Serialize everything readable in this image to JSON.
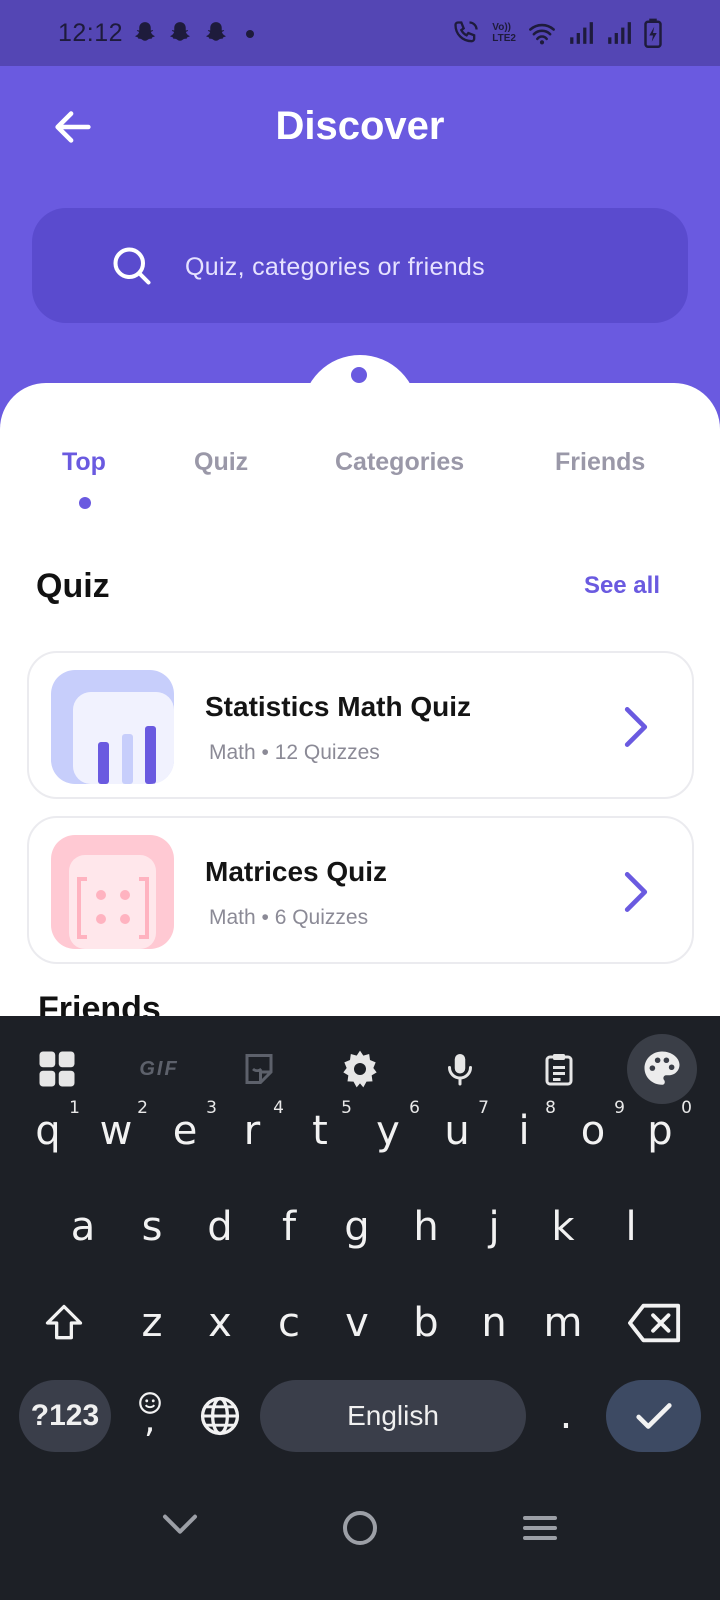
{
  "status_bar": {
    "time": "12:12",
    "notification_icons": [
      "snapchat-icon",
      "snapchat-icon",
      "snapchat-icon"
    ],
    "system_icons": [
      "call-wifi-icon",
      "volte-icon",
      "wifi-icon",
      "signal-icon",
      "signal-icon",
      "battery-charging-icon"
    ],
    "volte_label_top": "Vo))",
    "volte_label_bottom": "LTE2"
  },
  "header": {
    "title": "Discover",
    "back_icon": "arrow-left-icon"
  },
  "search": {
    "placeholder": "Quiz, categories or friends",
    "icon": "search-icon"
  },
  "tabs": [
    {
      "label": "Top",
      "active": true
    },
    {
      "label": "Quiz",
      "active": false
    },
    {
      "label": "Categories",
      "active": false
    },
    {
      "label": "Friends",
      "active": false
    }
  ],
  "quiz_section": {
    "title": "Quiz",
    "see_all": "See all",
    "items": [
      {
        "title": "Statistics Math Quiz",
        "meta": "Math • 12 Quizzes",
        "thumb_color": "#C7CEFB",
        "accent": "#6A5AE0"
      },
      {
        "title": "Matrices Quiz",
        "meta": "Math • 6 Quizzes",
        "thumb_color": "#FFC9D3",
        "accent": "#FFB3C0"
      }
    ]
  },
  "friends_section": {
    "title": "Friends"
  },
  "keyboard": {
    "toolbar": [
      "apps-grid-icon",
      "gif-icon",
      "sticker-icon",
      "settings-gear-icon",
      "microphone-icon",
      "clipboard-icon",
      "palette-icon"
    ],
    "gif_label": "GIF",
    "row1": [
      {
        "k": "q",
        "n": "1"
      },
      {
        "k": "w",
        "n": "2"
      },
      {
        "k": "e",
        "n": "3"
      },
      {
        "k": "r",
        "n": "4"
      },
      {
        "k": "t",
        "n": "5"
      },
      {
        "k": "y",
        "n": "6"
      },
      {
        "k": "u",
        "n": "7"
      },
      {
        "k": "i",
        "n": "8"
      },
      {
        "k": "o",
        "n": "9"
      },
      {
        "k": "p",
        "n": "0"
      }
    ],
    "row2": [
      "a",
      "s",
      "d",
      "f",
      "g",
      "h",
      "j",
      "k",
      "l"
    ],
    "row3": [
      "z",
      "x",
      "c",
      "v",
      "b",
      "n",
      "m"
    ],
    "symbols_label": "?123",
    "space_label": "English",
    "period_label": ".",
    "emoji_comma": ",",
    "colors": {
      "background": "#1D2026",
      "key_pill": "#3a3e4a",
      "enter": "#3d4a63"
    }
  },
  "nav_bar": [
    "chevron-down-icon",
    "home-circle-icon",
    "menu-lines-icon"
  ],
  "colors": {
    "primary": "#6A5AE0",
    "status_bar": "#5446B4",
    "search_bg": "#5A4BCE"
  }
}
